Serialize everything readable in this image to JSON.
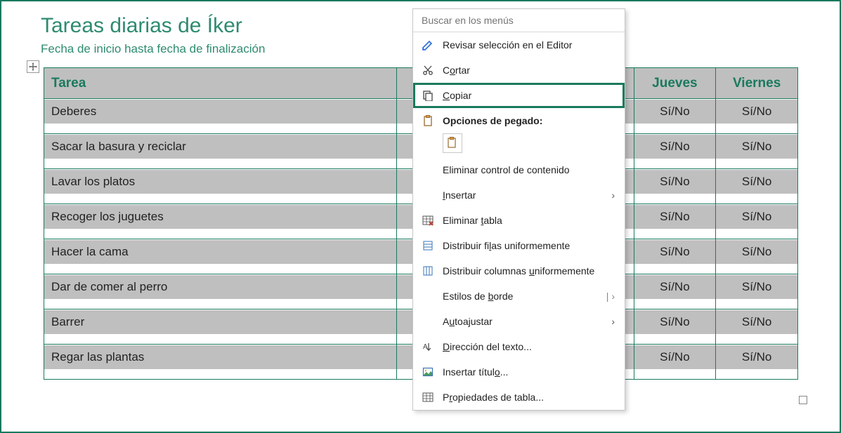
{
  "doc": {
    "title": "Tareas diarias de Íker",
    "subtitle": "Fecha de inicio hasta fecha de finalización"
  },
  "table": {
    "headers": {
      "task": "Tarea",
      "jueves": "Jueves",
      "viernes": "Viernes"
    },
    "cell_value": "Sí/No",
    "rows": [
      {
        "task": "Deberes"
      },
      {
        "task": "Sacar la basura y reciclar"
      },
      {
        "task": "Lavar los platos"
      },
      {
        "task": "Recoger los juguetes"
      },
      {
        "task": "Hacer la cama"
      },
      {
        "task": "Dar de comer al perro"
      },
      {
        "task": "Barrer"
      },
      {
        "task": "Regar las plantas"
      }
    ]
  },
  "menu": {
    "search_placeholder": "Buscar en los menús",
    "review": "Revisar selección en el Editor",
    "cut": "Cortar",
    "copy": "Copiar",
    "paste_options": "Opciones de pegado:",
    "delete_cc": "Eliminar control de contenido",
    "insert": "Insertar",
    "delete_table": "Eliminar tabla",
    "dist_rows": "Distribuir filas uniformemente",
    "dist_cols": "Distribuir columnas uniformemente",
    "border_styles": "Estilos de borde",
    "autofit": "Autoajustar",
    "text_dir": "Dirección del texto...",
    "insert_caption": "Insertar título...",
    "table_props": "Propiedades de tabla..."
  }
}
